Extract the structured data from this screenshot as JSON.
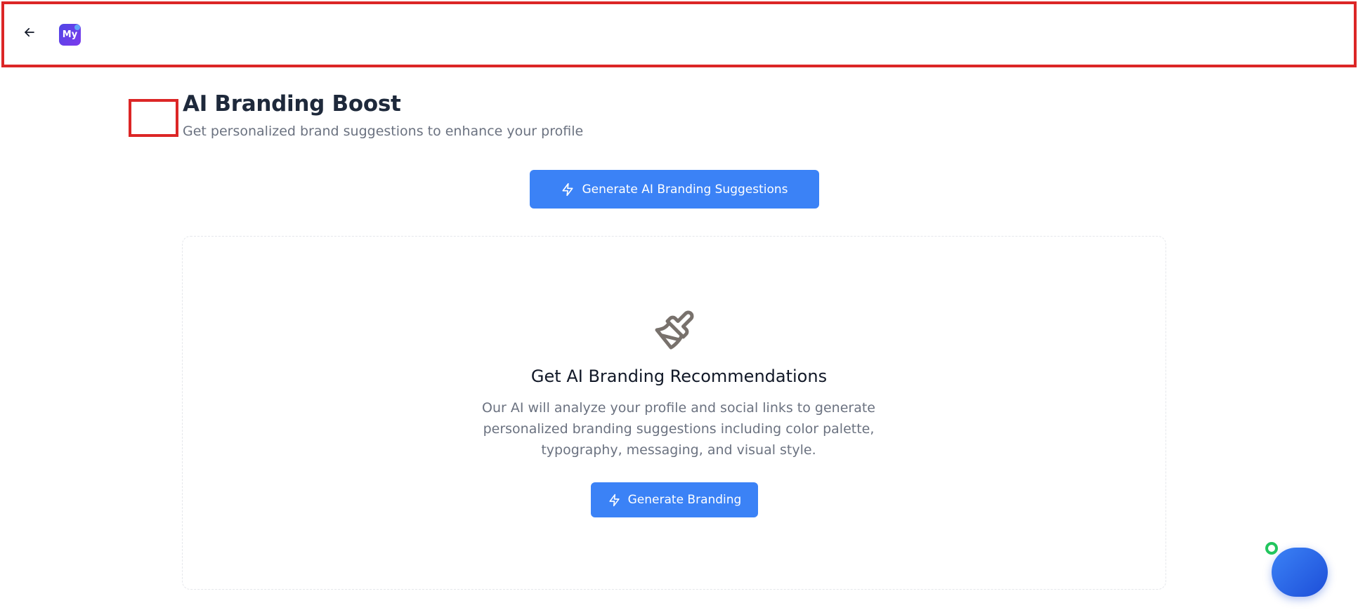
{
  "header": {
    "logo_text": "My",
    "back_icon": "arrow-left-icon"
  },
  "page": {
    "title": "AI Branding Boost",
    "subtitle": "Get personalized brand suggestions to enhance your profile"
  },
  "actions": {
    "generate_suggestions_label": "Generate AI Branding Suggestions"
  },
  "card": {
    "icon": "paintbrush-icon",
    "title": "Get AI Branding Recommendations",
    "description": "Our AI will analyze your profile and social links to generate personalized branding suggestions including color palette, typography, messaging, and visual style.",
    "button_label": "Generate Branding"
  },
  "colors": {
    "accent": "#3b82f6",
    "highlight_border": "#dc2626",
    "status": "#22c55e"
  }
}
